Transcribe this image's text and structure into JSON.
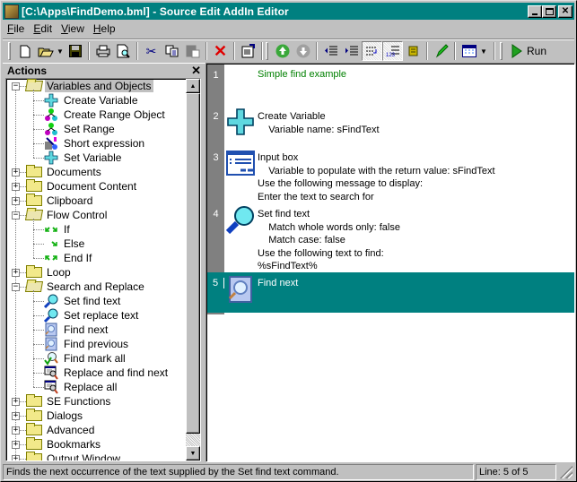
{
  "window": {
    "title": "[C:\\Apps\\FindDemo.bml] - Source Edit AddIn Editor",
    "controls": {
      "minimize": "_",
      "maximize": "□",
      "close": "✕"
    }
  },
  "menu": [
    {
      "label": "File",
      "accel": "F"
    },
    {
      "label": "Edit",
      "accel": "E"
    },
    {
      "label": "View",
      "accel": "V"
    },
    {
      "label": "Help",
      "accel": "H"
    }
  ],
  "toolbar": {
    "buttons": [
      {
        "name": "new-document",
        "icon": "new-document-icon"
      },
      {
        "name": "open",
        "icon": "open-folder-icon"
      },
      {
        "name": "save",
        "icon": "floppy-disk-icon"
      },
      {
        "name": "print",
        "icon": "printer-icon"
      },
      {
        "name": "print-preview",
        "icon": "print-preview-icon"
      },
      {
        "name": "cut",
        "icon": "scissors-icon"
      },
      {
        "name": "copy",
        "icon": "copy-icon"
      },
      {
        "name": "paste",
        "icon": "paste-icon",
        "disabled": true
      },
      {
        "name": "delete",
        "icon": "red-x-icon"
      },
      {
        "name": "properties",
        "icon": "properties-icon"
      },
      {
        "name": "move-up",
        "icon": "arrow-up-circle-icon"
      },
      {
        "name": "move-down",
        "icon": "arrow-down-circle-icon",
        "disabled": true
      },
      {
        "name": "outdent",
        "icon": "outdent-icon"
      },
      {
        "name": "indent",
        "icon": "indent-icon"
      },
      {
        "name": "word-wrap",
        "icon": "word-wrap-icon",
        "pressed": true
      },
      {
        "name": "line-numbers",
        "icon": "line-numbers-icon",
        "pressed": true
      },
      {
        "name": "script",
        "icon": "scroll-icon"
      },
      {
        "name": "highlight",
        "icon": "green-marker-icon"
      },
      {
        "name": "view-options",
        "icon": "window-grid-icon"
      }
    ],
    "run_label": "Run"
  },
  "actions_panel": {
    "title": "Actions",
    "close_glyph": "✕",
    "tree": [
      {
        "label": "Variables and Objects",
        "expanded": true,
        "selected": true,
        "children": [
          {
            "label": "Create Variable",
            "icon": "cross-variable-icon"
          },
          {
            "label": "Create Range Object",
            "icon": "molecule-icon"
          },
          {
            "label": "Set Range",
            "icon": "molecule-icon"
          },
          {
            "label": "Short expression",
            "icon": "expression-icon"
          },
          {
            "label": "Set Variable",
            "icon": "cross-variable-icon"
          }
        ]
      },
      {
        "label": "Documents",
        "expanded": false
      },
      {
        "label": "Document Content",
        "expanded": false
      },
      {
        "label": "Clipboard",
        "expanded": false
      },
      {
        "label": "Flow Control",
        "expanded": true,
        "children": [
          {
            "label": "If",
            "icon": "branch-arrows-icon"
          },
          {
            "label": "Else",
            "icon": "else-arrow-icon"
          },
          {
            "label": "End If",
            "icon": "merge-arrows-icon"
          }
        ]
      },
      {
        "label": "Loop",
        "expanded": false
      },
      {
        "label": "Search and Replace",
        "expanded": true,
        "children": [
          {
            "label": "Set find text",
            "icon": "magnifier-icon"
          },
          {
            "label": "Set replace text",
            "icon": "magnifier-icon"
          },
          {
            "label": "Find next",
            "icon": "find-document-icon"
          },
          {
            "label": "Find previous",
            "icon": "find-document-icon"
          },
          {
            "label": "Find mark all",
            "icon": "find-mark-icon"
          },
          {
            "label": "Replace and find next",
            "icon": "replace-icon"
          },
          {
            "label": "Replace all",
            "icon": "replace-icon"
          }
        ]
      },
      {
        "label": "SE Functions",
        "expanded": false
      },
      {
        "label": "Dialogs",
        "expanded": false
      },
      {
        "label": "Advanced",
        "expanded": false
      },
      {
        "label": "Bookmarks",
        "expanded": false
      },
      {
        "label": "Output Window",
        "expanded": false
      }
    ]
  },
  "editor": {
    "lines": [
      {
        "num": "1",
        "icon": "",
        "text": [
          "Simple find example"
        ],
        "comment": true
      },
      {
        "num": "2",
        "icon": "cross-variable-icon",
        "text": [
          "Create Variable",
          "    Variable name: sFindText"
        ]
      },
      {
        "num": "3",
        "icon": "input-box-icon",
        "text": [
          "Input box",
          "    Variable to populate with the return value: sFindText",
          "Use the following message to display:",
          "Enter the text to search for"
        ]
      },
      {
        "num": "4",
        "icon": "magnifier-icon",
        "text": [
          "Set find text",
          "    Match whole words only: false",
          "    Match case: false",
          "Use the following text to find:",
          "%sFindText%"
        ]
      },
      {
        "num": "5",
        "icon": "find-document-icon",
        "text": [
          "Find next"
        ],
        "selected": true
      }
    ]
  },
  "statusbar": {
    "message": "Finds the next occurrence of the text supplied by the Set find text command.",
    "line_info": "Line: 5 of 5"
  },
  "colors": {
    "title_bar": "#008080",
    "selection": "#008080",
    "comment": "#008000",
    "gutter": "#808080"
  }
}
